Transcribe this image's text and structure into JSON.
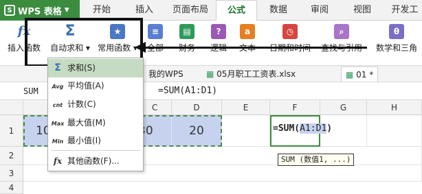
{
  "app": {
    "name": "WPS 表格",
    "logo": "S"
  },
  "tabs": [
    "开始",
    "插入",
    "页面布局",
    "公式",
    "数据",
    "审阅",
    "视图",
    "开发工"
  ],
  "active_tab": "公式",
  "ribbon": {
    "insert_function": "插入函数",
    "autosum": "自动求和",
    "common_functions": "常用函数",
    "all": "全部",
    "finance": "财务",
    "logic": "逻辑",
    "text": "文本",
    "datetime": "日期和时间",
    "lookup": "查找与引用",
    "math": "数学和三角"
  },
  "doc_tabs": {
    "mywps": "我的WPS",
    "file1": "05月职工工资表.xlsx",
    "file2": "01 *"
  },
  "formula_bar": {
    "name_box": "SUM",
    "formula": "=SUM(A1:D1)"
  },
  "columns": [
    "C",
    "D",
    "E",
    "F",
    "G",
    "H"
  ],
  "rows": [
    "1",
    "2",
    "3",
    "4"
  ],
  "cells": {
    "a1": "10",
    "c1": "30",
    "d1": "20"
  },
  "edit_cell": {
    "prefix": "=SUM(",
    "ref": "A1:D1",
    "suffix": ")"
  },
  "tooltip": "SUM (数值1, ...)",
  "menu": [
    {
      "icon": "Σ",
      "label": "求和(S)"
    },
    {
      "icon": "Avg",
      "label": "平均值(A)"
    },
    {
      "icon": "cnt",
      "label": "计数(C)"
    },
    {
      "icon": "Max",
      "label": "最大值(M)"
    },
    {
      "icon": "Min",
      "label": "最小值(I)"
    },
    {
      "icon": "fx",
      "label": "其他函数(F)..."
    }
  ],
  "colors": {
    "brand": "#3b8c3f",
    "selection": "#c6d2ee",
    "menu_highlight": "#c6dbc3"
  }
}
